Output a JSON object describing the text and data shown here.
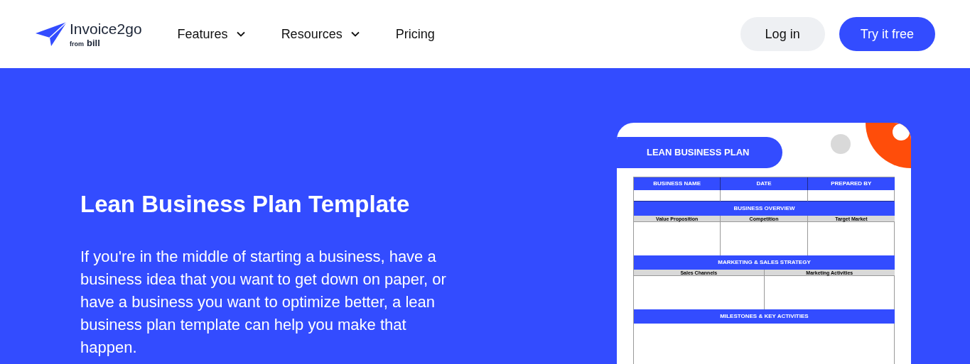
{
  "header": {
    "logo": {
      "name": "Invoice2go",
      "tagline_prefix": "from",
      "tagline_brand": "bill"
    },
    "nav": [
      {
        "label": "Features",
        "has_menu": true
      },
      {
        "label": "Resources",
        "has_menu": true
      },
      {
        "label": "Pricing",
        "has_menu": false
      }
    ],
    "login": "Log in",
    "cta": "Try it free"
  },
  "hero": {
    "title": "Lean Business Plan Template",
    "description": "If you're in the middle of starting a business, have a business idea that you want to get down on paper, or have a business you want to optimize better, a lean business plan template can help you make that happen."
  },
  "template_preview": {
    "title": "LEAN BUSINESS PLAN",
    "sections": [
      {
        "kind": "columns",
        "headers": [
          "BUSINESS NAME",
          "DATE",
          "PREPARED BY"
        ]
      },
      {
        "kind": "section",
        "title": "BUSINESS OVERVIEW",
        "subheaders": [
          "Value Proposition",
          "Competition",
          "Target Market"
        ]
      },
      {
        "kind": "section",
        "title": "MARKETING & SALES STRATEGY",
        "subheaders": [
          "Sales Channels",
          "Marketing Activities"
        ]
      },
      {
        "kind": "section",
        "title": "MILESTONES & KEY ACTIVITIES"
      }
    ]
  }
}
